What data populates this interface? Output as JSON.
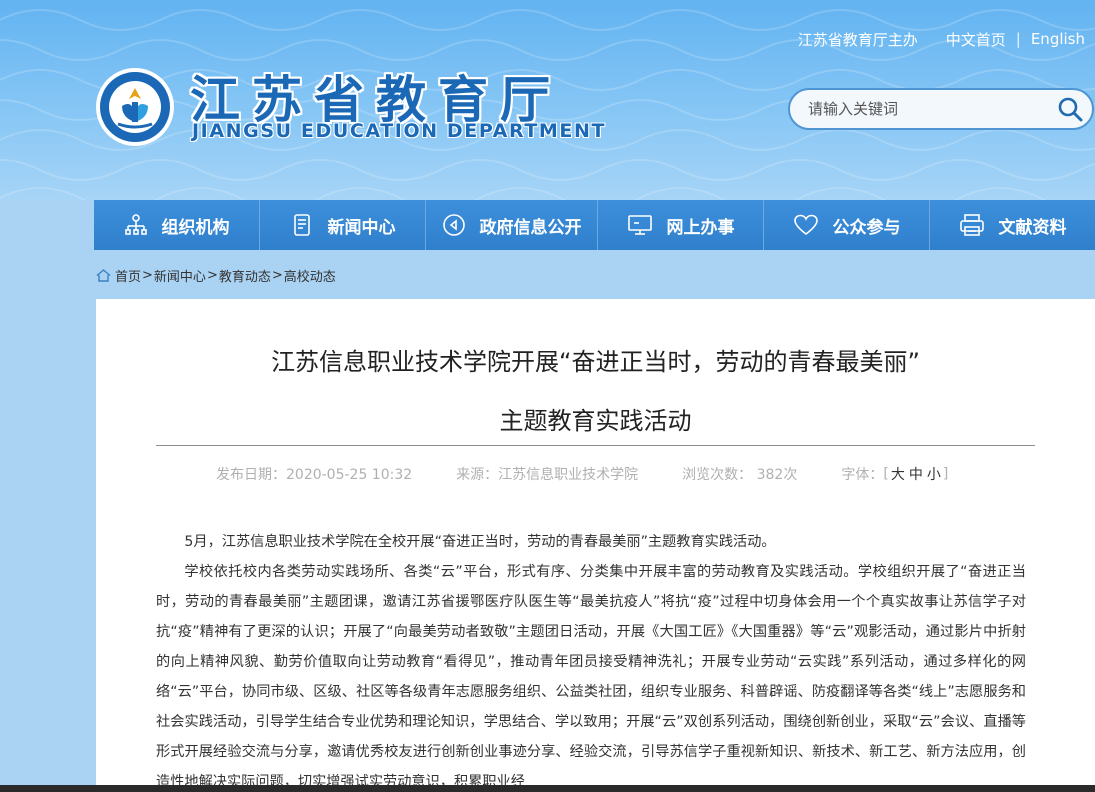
{
  "header": {
    "top_links": {
      "sponsor": "江苏省教育厅主办",
      "home_cn": "中文首页",
      "separator": "|",
      "english": "English"
    },
    "logo": {
      "name_cn": "江苏省教育厅",
      "name_en": "JIANGSU EDUCATION DEPARTMENT"
    },
    "search": {
      "placeholder": "请输入关键词"
    }
  },
  "nav": {
    "items": [
      {
        "label": "组织机构",
        "icon": "org-chart-icon"
      },
      {
        "label": "新闻中心",
        "icon": "document-icon"
      },
      {
        "label": "政府信息公开",
        "icon": "play-circle-icon"
      },
      {
        "label": "网上办事",
        "icon": "monitor-icon"
      },
      {
        "label": "公众参与",
        "icon": "heart-icon"
      },
      {
        "label": "文献资料",
        "icon": "printer-icon"
      }
    ]
  },
  "breadcrumb": {
    "items": [
      "首页",
      "新闻中心",
      "教育动态",
      "高校动态"
    ],
    "arrow": ">"
  },
  "article": {
    "title_line1": "江苏信息职业技术学院开展“奋进正当时，劳动的青春最美丽”",
    "title_line2": "主题教育实践活动",
    "meta": {
      "date": "发布日期：2020-05-25 10:32",
      "source": "来源：江苏信息职业技术学院",
      "views": "浏览次数：  382次",
      "font_label": "字体：",
      "bracket_open": "[",
      "font_large": "大",
      "font_medium": "中",
      "font_small": "小",
      "bracket_close": "]"
    },
    "paragraphs": [
      "5月，江苏信息职业技术学院在全校开展“奋进正当时，劳动的青春最美丽”主题教育实践活动。",
      "学校依托校内各类劳动实践场所、各类“云”平台，形式有序、分类集中开展丰富的劳动教育及实践活动。学校组织开展了“奋进正当时，劳动的青春最美丽”主题团课，邀请江苏省援鄂医疗队医生等“最美抗疫人”将抗“疫”过程中切身体会用一个个真实故事让苏信学子对抗“疫”精神有了更深的认识；开展了“向最美劳动者致敬”主题团日活动，开展《大国工匠》《大国重器》等“云”观影活动，通过影片中折射的向上精神风貌、勤劳价值取向让劳动教育“看得见”，推动青年团员接受精神洗礼；开展专业劳动“云实践”系列活动，通过多样化的网络“云”平台，协同市级、区级、社区等各级青年志愿服务组织、公益类社团，组织专业服务、科普辟谣、防疫翻译等各类“线上”志愿服务和社会实践活动，引导学生结合专业优势和理论知识，学思结合、学以致用；开展“云”双创系列活动，围绕创新创业，采取“云”会议、直播等形式开展经验交流与分享，邀请优秀校友进行创新创业事迹分享、经验交流，引导苏信学子重视新知识、新技术、新工艺、新方法应用，创造性地解决实际问题，切实增强试实劳动意识，积累职业经"
    ]
  },
  "colors": {
    "header_top": "#62b3f1",
    "nav_bg": "#3d8fdb",
    "logo_blue": "#1a68b6",
    "page_bg": "#a9d2f3"
  }
}
